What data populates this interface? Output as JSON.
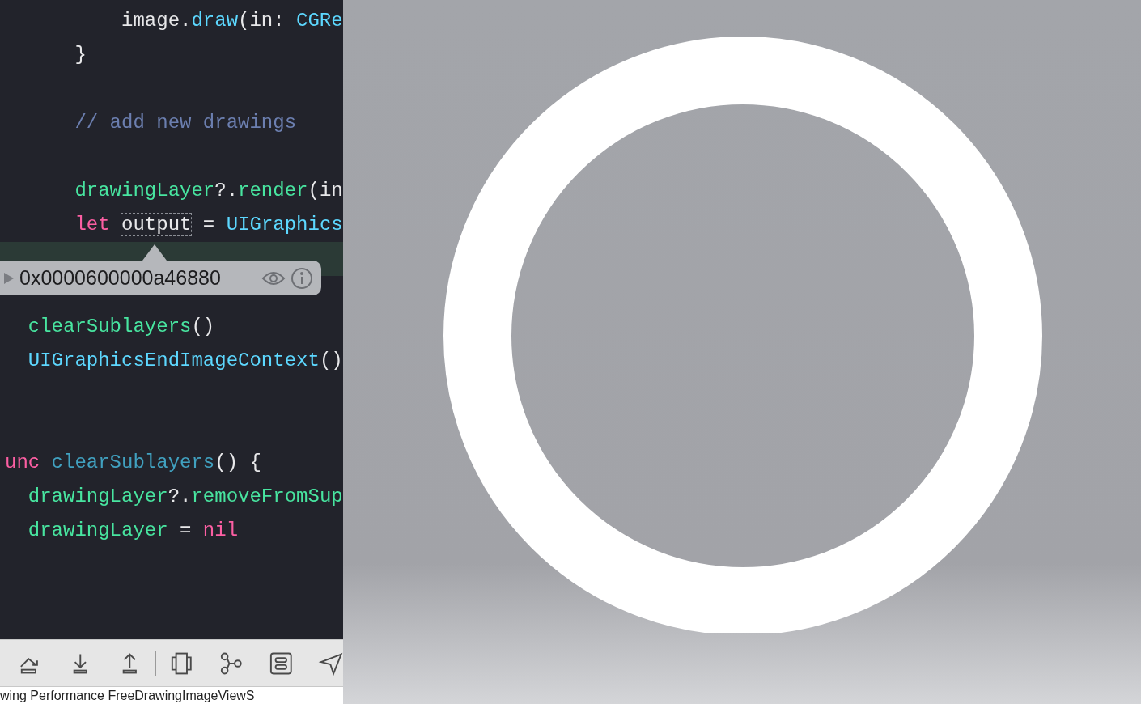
{
  "editor": {
    "lines": [
      {
        "kind": "code",
        "tokens": [
          {
            "text": "          image.",
            "kind": "plain"
          },
          {
            "text": "draw",
            "kind": "type"
          },
          {
            "text": "(in: ",
            "kind": "plain"
          },
          {
            "text": "CGRe",
            "kind": "type"
          }
        ]
      },
      {
        "kind": "code",
        "tokens": [
          {
            "text": "      }",
            "kind": "plain"
          }
        ]
      },
      {
        "kind": "blank"
      },
      {
        "kind": "code",
        "tokens": [
          {
            "text": "      // add new drawings",
            "kind": "comment"
          }
        ]
      },
      {
        "kind": "blank"
      },
      {
        "kind": "code",
        "tokens": [
          {
            "text": "      drawingLayer",
            "kind": "project"
          },
          {
            "text": "?.",
            "kind": "plain"
          },
          {
            "text": "render",
            "kind": "project"
          },
          {
            "text": "(in",
            "kind": "plain"
          }
        ]
      },
      {
        "kind": "code",
        "tokens": [
          {
            "text": "      let ",
            "kind": "keyword"
          },
          {
            "text": "output",
            "kind": "outlined"
          },
          {
            "text": " = ",
            "kind": "plain"
          },
          {
            "text": "UIGraphics",
            "kind": "type"
          }
        ]
      },
      {
        "kind": "current"
      },
      {
        "kind": "blank"
      },
      {
        "kind": "code",
        "tokens": [
          {
            "text": "  clearSublayers",
            "kind": "project"
          },
          {
            "text": "()",
            "kind": "plain"
          }
        ]
      },
      {
        "kind": "code",
        "tokens": [
          {
            "text": "  UIGraphicsEndImageContext",
            "kind": "type"
          },
          {
            "text": "()",
            "kind": "plain"
          }
        ]
      },
      {
        "kind": "blank"
      },
      {
        "kind": "blank"
      },
      {
        "kind": "code",
        "tokens": [
          {
            "text": "unc ",
            "kind": "keyword"
          },
          {
            "text": "clearSublayers",
            "kind": "decl"
          },
          {
            "text": "() {",
            "kind": "plain"
          }
        ]
      },
      {
        "kind": "code",
        "tokens": [
          {
            "text": "  drawingLayer",
            "kind": "project"
          },
          {
            "text": "?.",
            "kind": "plain"
          },
          {
            "text": "removeFromSup",
            "kind": "project"
          }
        ]
      },
      {
        "kind": "code",
        "tokens": [
          {
            "text": "  drawingLayer",
            "kind": "project"
          },
          {
            "text": " = ",
            "kind": "plain"
          },
          {
            "text": "nil",
            "kind": "keyword"
          }
        ]
      }
    ]
  },
  "popover": {
    "value": "0x0000600000a46880"
  },
  "status_bar": {
    "path": "wing Performance FreeDrawingImageViewS"
  }
}
